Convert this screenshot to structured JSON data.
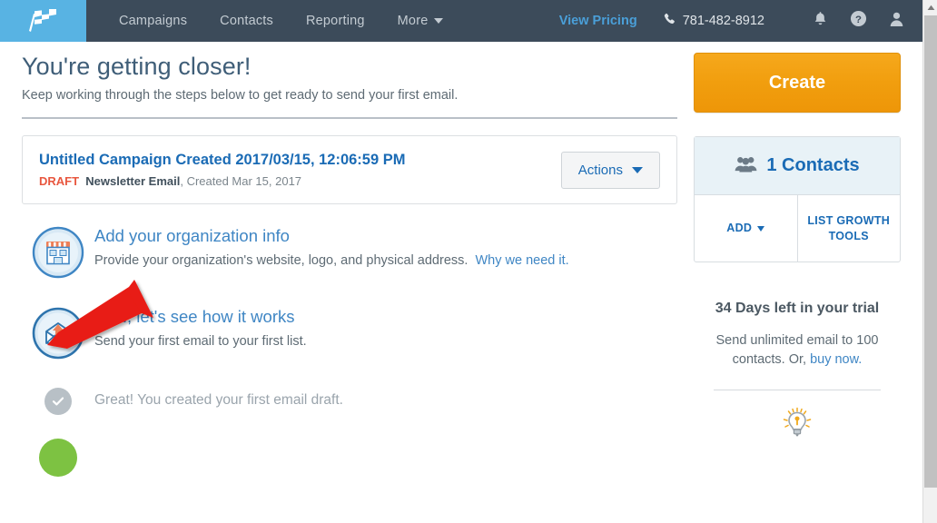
{
  "nav": {
    "logo_icon": "checkered-flag-icon",
    "links": [
      "Campaigns",
      "Contacts",
      "Reporting"
    ],
    "more_label": "More",
    "view_pricing": "View Pricing",
    "phone": "781-482-8912",
    "phone_icon": "phone-icon",
    "bell_icon": "bell-icon",
    "help_icon": "question-circle-icon",
    "account_icon": "user-icon"
  },
  "header": {
    "title": "You're getting closer!",
    "subtitle": "Keep working through the steps below to get ready to send your first email."
  },
  "campaign": {
    "title": "Untitled Campaign Created 2017/03/15, 12:06:59 PM",
    "status": "DRAFT",
    "type": "Newsletter Email",
    "created": ", Created Mar 15, 2017",
    "actions_label": "Actions"
  },
  "steps": [
    {
      "icon": "storefront-icon",
      "title": "Add your organization info",
      "desc": "Provide your organization's website, logo, and physical address.",
      "link": "Why we need it.",
      "state": "pending"
    },
    {
      "icon": "envelope-up-arrow-icon",
      "title": "Now, let's see how it works",
      "desc": "Send your first email to your first list.",
      "link": "",
      "state": "pending"
    },
    {
      "icon": "check-circle-icon",
      "title": "",
      "desc": "Great! You created your first email draft.",
      "link": "",
      "state": "done"
    }
  ],
  "sidebar": {
    "create_label": "Create",
    "contacts_icon": "people-icon",
    "contacts_count": "1 Contacts",
    "add_label": "ADD",
    "list_growth_label": "LIST GROWTH TOOLS",
    "trial_title": "34 Days left in your trial",
    "trial_desc_before": "Send unlimited email to 100 contacts. Or, ",
    "trial_link": "buy now.",
    "tip_icon": "lightbulb-icon"
  },
  "annotation": {
    "type": "red-arrow",
    "color": "#e81c12"
  },
  "colors": {
    "nav_bg": "#3c4b5a",
    "logo_tile": "#58b3e3",
    "accent_blue": "#1a6bb5",
    "link_blue": "#3f86c4",
    "create_orange": "#f0a015",
    "draft_red": "#e8573f",
    "green": "#7dc242"
  }
}
